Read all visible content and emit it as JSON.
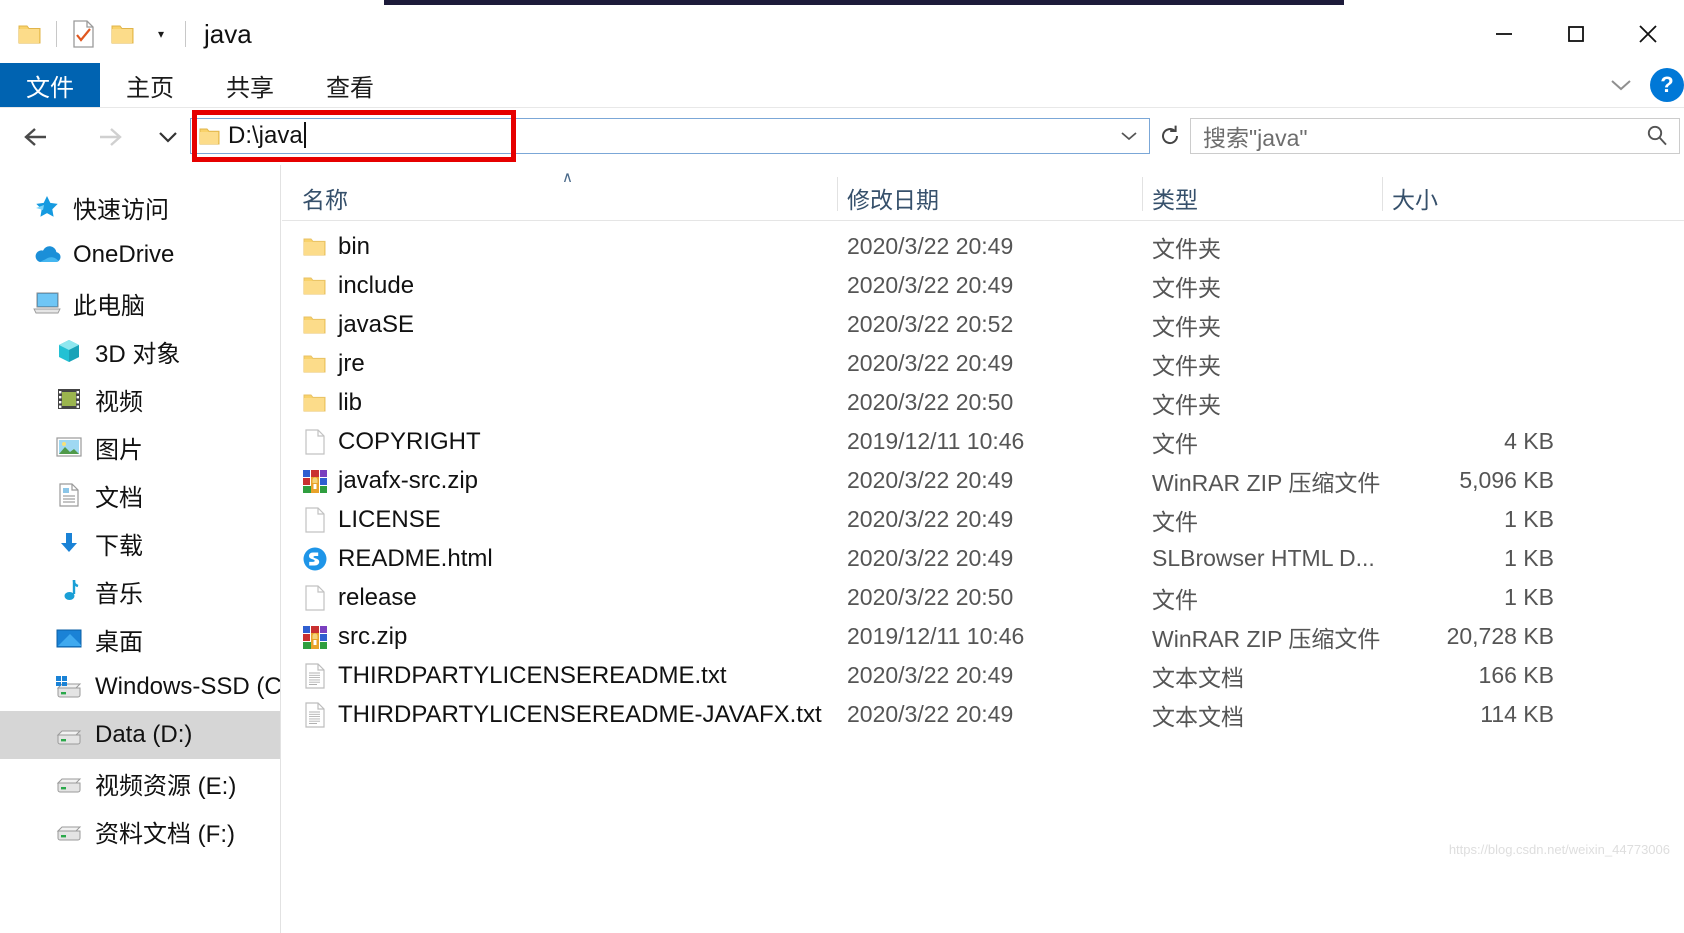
{
  "window": {
    "title": "java",
    "minimize_label": "最小化",
    "maximize_label": "最大化",
    "close_label": "关闭"
  },
  "quick_access": {
    "items": [
      {
        "name": "folder-icon",
        "label": ""
      },
      {
        "name": "properties-icon",
        "label": ""
      },
      {
        "name": "new-folder-icon",
        "label": ""
      }
    ],
    "customize_label": "▾"
  },
  "ribbon": {
    "tabs": [
      {
        "label": "文件",
        "active": true
      },
      {
        "label": "主页",
        "active": false
      },
      {
        "label": "共享",
        "active": false
      },
      {
        "label": "查看",
        "active": false
      }
    ],
    "expand_label": "∨",
    "help_label": "?"
  },
  "navigation": {
    "back_label": "←",
    "forward_label": "→",
    "recent_label": "∨",
    "up_label": "↑"
  },
  "address": {
    "value": "D:\\java",
    "dropdown_label": "∨",
    "refresh_label": "↻",
    "highlight_color": "#e60000"
  },
  "search": {
    "placeholder": "搜索\"java\"",
    "icon": "search-icon"
  },
  "sidebar": {
    "items": [
      {
        "label": "快速访问",
        "icon": "pin-star-icon",
        "level": 0,
        "selected": false
      },
      {
        "label": "OneDrive",
        "icon": "onedrive-cloud-icon",
        "level": 0,
        "selected": false
      },
      {
        "label": "此电脑",
        "icon": "this-pc-icon",
        "level": 0,
        "selected": false
      },
      {
        "label": "3D 对象",
        "icon": "3d-objects-icon",
        "level": 1,
        "selected": false
      },
      {
        "label": "视频",
        "icon": "videos-icon",
        "level": 1,
        "selected": false
      },
      {
        "label": "图片",
        "icon": "pictures-icon",
        "level": 1,
        "selected": false
      },
      {
        "label": "文档",
        "icon": "documents-icon",
        "level": 1,
        "selected": false
      },
      {
        "label": "下载",
        "icon": "downloads-icon",
        "level": 1,
        "selected": false
      },
      {
        "label": "音乐",
        "icon": "music-icon",
        "level": 1,
        "selected": false
      },
      {
        "label": "桌面",
        "icon": "desktop-icon",
        "level": 1,
        "selected": false
      },
      {
        "label": "Windows-SSD (C:)",
        "icon": "system-drive-icon",
        "level": 1,
        "selected": false
      },
      {
        "label": "Data (D:)",
        "icon": "drive-icon",
        "level": 1,
        "selected": true
      },
      {
        "label": "视频资源 (E:)",
        "icon": "drive-icon",
        "level": 1,
        "selected": false
      },
      {
        "label": "资料文档 (F:)",
        "icon": "drive-icon",
        "level": 1,
        "selected": false
      }
    ]
  },
  "file_list": {
    "columns": [
      {
        "label": "名称",
        "sorted": "asc"
      },
      {
        "label": "修改日期",
        "sorted": ""
      },
      {
        "label": "类型",
        "sorted": ""
      },
      {
        "label": "大小",
        "sorted": ""
      }
    ],
    "rows": [
      {
        "name": "bin",
        "date": "2020/3/22 20:49",
        "type": "文件夹",
        "size": "",
        "icon": "folder-icon"
      },
      {
        "name": "include",
        "date": "2020/3/22 20:49",
        "type": "文件夹",
        "size": "",
        "icon": "folder-icon"
      },
      {
        "name": "javaSE",
        "date": "2020/3/22 20:52",
        "type": "文件夹",
        "size": "",
        "icon": "folder-icon"
      },
      {
        "name": "jre",
        "date": "2020/3/22 20:49",
        "type": "文件夹",
        "size": "",
        "icon": "folder-icon"
      },
      {
        "name": "lib",
        "date": "2020/3/22 20:50",
        "type": "文件夹",
        "size": "",
        "icon": "folder-icon"
      },
      {
        "name": "COPYRIGHT",
        "date": "2019/12/11 10:46",
        "type": "文件",
        "size": "4 KB",
        "icon": "blank-file-icon"
      },
      {
        "name": "javafx-src.zip",
        "date": "2020/3/22 20:49",
        "type": "WinRAR ZIP 压缩文件",
        "size": "5,096 KB",
        "icon": "winrar-zip-icon"
      },
      {
        "name": "LICENSE",
        "date": "2020/3/22 20:49",
        "type": "文件",
        "size": "1 KB",
        "icon": "blank-file-icon"
      },
      {
        "name": "README.html",
        "date": "2020/3/22 20:49",
        "type": "SLBrowser HTML D...",
        "size": "1 KB",
        "icon": "slbrowser-html-icon"
      },
      {
        "name": "release",
        "date": "2020/3/22 20:50",
        "type": "文件",
        "size": "1 KB",
        "icon": "blank-file-icon"
      },
      {
        "name": "src.zip",
        "date": "2019/12/11 10:46",
        "type": "WinRAR ZIP 压缩文件",
        "size": "20,728 KB",
        "icon": "winrar-zip-icon"
      },
      {
        "name": "THIRDPARTYLICENSEREADME.txt",
        "date": "2020/3/22 20:49",
        "type": "文本文档",
        "size": "166 KB",
        "icon": "text-file-icon"
      },
      {
        "name": "THIRDPARTYLICENSEREADME-JAVAFX.txt",
        "date": "2020/3/22 20:49",
        "type": "文本文档",
        "size": "114 KB",
        "icon": "text-file-icon"
      }
    ]
  },
  "watermark": {
    "text": "https://blog.csdn.net/weixin_44773006"
  }
}
